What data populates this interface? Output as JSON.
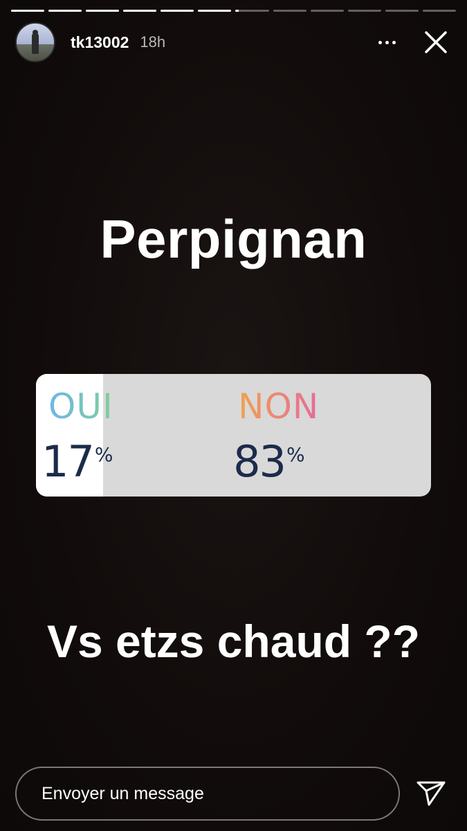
{
  "header": {
    "username": "tk13002",
    "time": "18h"
  },
  "progress": {
    "segments": [
      1,
      1,
      1,
      1,
      1,
      1,
      0.1,
      0,
      0,
      0,
      0,
      0
    ]
  },
  "story": {
    "title": "Perpignan",
    "question": "Vs etzs chaud ??"
  },
  "poll": {
    "options": [
      {
        "label": "OUI",
        "percent": "17",
        "symbol": "%",
        "share": 0.17
      },
      {
        "label": "NON",
        "percent": "83",
        "symbol": "%",
        "share": 0.83
      }
    ]
  },
  "message": {
    "placeholder": "Envoyer un message"
  },
  "icons": {
    "more": "more-dots-icon",
    "close": "close-icon",
    "send": "send-icon"
  }
}
